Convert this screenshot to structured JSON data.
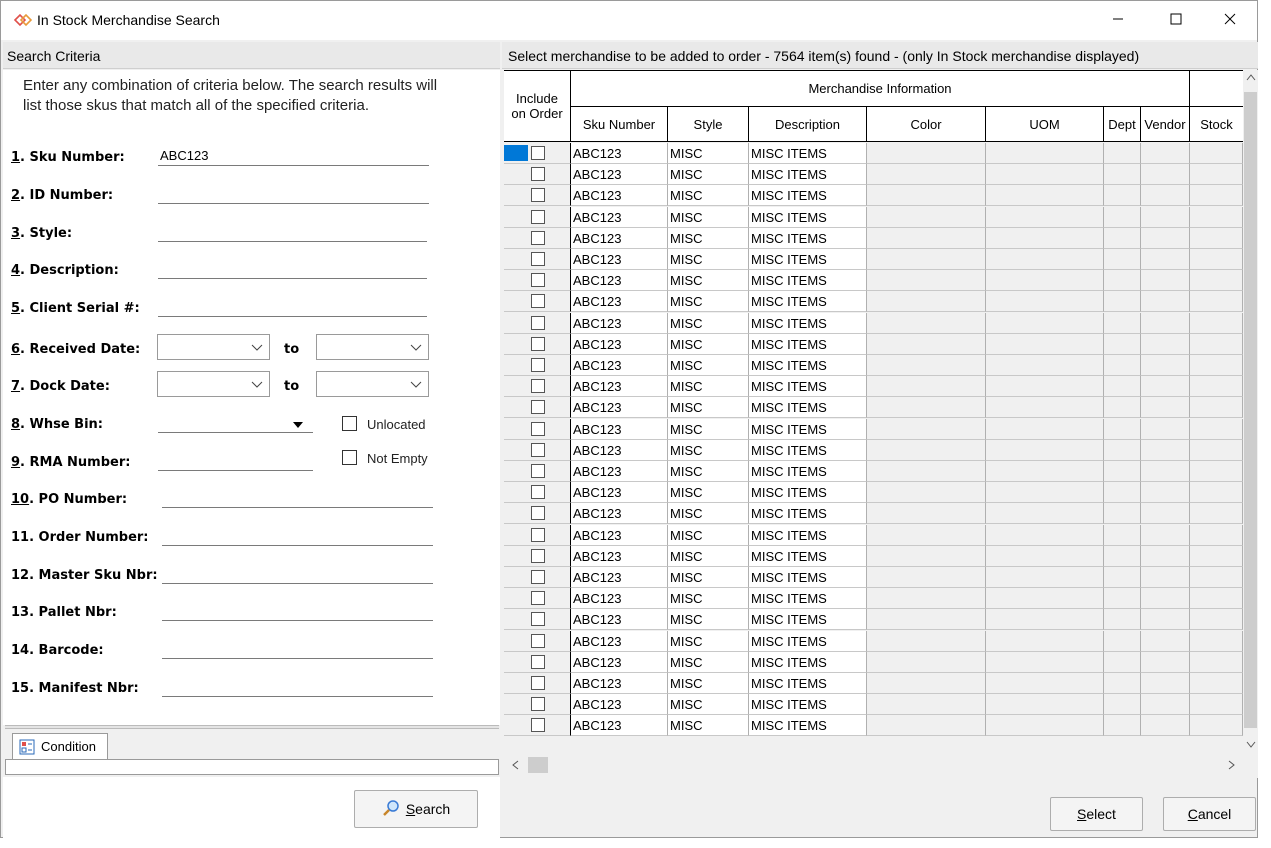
{
  "window": {
    "title": "In Stock Merchandise Search",
    "icons": [
      "app-logo-icon",
      "minimize-icon",
      "maximize-icon",
      "close-icon"
    ]
  },
  "criteria": {
    "header": "Search Criteria",
    "intro": "Enter any combination of criteria below.  The search results will list those skus that match all of the specified criteria.",
    "fields": {
      "sku": {
        "num": "1",
        "label": ". Sku Number:",
        "value": "ABC123"
      },
      "id": {
        "num": "2",
        "label": ". ID Number:",
        "value": ""
      },
      "style": {
        "num": "3",
        "label": ". Style:",
        "value": ""
      },
      "description": {
        "num": "4",
        "label": ". Description:",
        "value": ""
      },
      "serial": {
        "num": "5",
        "label": ". Client Serial #:",
        "value": ""
      },
      "received": {
        "num": "6",
        "label": ". Received Date:",
        "to": "to"
      },
      "dock": {
        "num": "7",
        "label": ". Dock Date:",
        "to": "to"
      },
      "whse": {
        "num": "8",
        "label": ". Whse Bin:",
        "value": ""
      },
      "rma": {
        "num": "9",
        "label": ". RMA Number:",
        "value": ""
      },
      "po": {
        "num": "10",
        "label": ". PO Number:",
        "value": ""
      },
      "order": {
        "num": "11",
        "label": ". Order Number:",
        "value": ""
      },
      "master": {
        "num": "12",
        "label": ". Master Sku Nbr:",
        "value": ""
      },
      "pallet": {
        "num": "13",
        "label": ". Pallet Nbr:",
        "value": ""
      },
      "barcode": {
        "num": "14",
        "label": ". Barcode:",
        "value": ""
      },
      "manifest": {
        "num": "15",
        "label": ". Manifest Nbr:",
        "value": ""
      }
    },
    "unlocated_label": "Unlocated",
    "not_empty_label": "Not Empty",
    "condition_tab": "Condition",
    "search_button": {
      "mnemonic": "S",
      "rest": "earch"
    }
  },
  "results": {
    "header": "Select merchandise to be added to order - 7564 item(s) found - (only In Stock merchandise displayed)",
    "include_header": "Include on Order",
    "group_header": "Merchandise Information",
    "columns": [
      "Sku Number",
      "Style",
      "Description",
      "Color",
      "UOM",
      "Dept",
      "Vendor",
      "Stock"
    ],
    "rows": [
      {
        "sku": "ABC123",
        "style": "MISC",
        "description": "MISC ITEMS",
        "checked": false
      },
      {
        "sku": "ABC123",
        "style": "MISC",
        "description": "MISC ITEMS",
        "checked": false
      },
      {
        "sku": "ABC123",
        "style": "MISC",
        "description": "MISC ITEMS",
        "checked": false
      },
      {
        "sku": "ABC123",
        "style": "MISC",
        "description": "MISC ITEMS",
        "checked": false
      },
      {
        "sku": "ABC123",
        "style": "MISC",
        "description": "MISC ITEMS",
        "checked": false
      },
      {
        "sku": "ABC123",
        "style": "MISC",
        "description": "MISC ITEMS",
        "checked": false
      },
      {
        "sku": "ABC123",
        "style": "MISC",
        "description": "MISC ITEMS",
        "checked": false
      },
      {
        "sku": "ABC123",
        "style": "MISC",
        "description": "MISC ITEMS",
        "checked": false
      },
      {
        "sku": "ABC123",
        "style": "MISC",
        "description": "MISC ITEMS",
        "checked": false
      },
      {
        "sku": "ABC123",
        "style": "MISC",
        "description": "MISC ITEMS",
        "checked": false
      },
      {
        "sku": "ABC123",
        "style": "MISC",
        "description": "MISC ITEMS",
        "checked": false
      },
      {
        "sku": "ABC123",
        "style": "MISC",
        "description": "MISC ITEMS",
        "checked": false
      },
      {
        "sku": "ABC123",
        "style": "MISC",
        "description": "MISC ITEMS",
        "checked": false
      },
      {
        "sku": "ABC123",
        "style": "MISC",
        "description": "MISC ITEMS",
        "checked": false
      },
      {
        "sku": "ABC123",
        "style": "MISC",
        "description": "MISC ITEMS",
        "checked": false
      },
      {
        "sku": "ABC123",
        "style": "MISC",
        "description": "MISC ITEMS",
        "checked": false
      },
      {
        "sku": "ABC123",
        "style": "MISC",
        "description": "MISC ITEMS",
        "checked": false
      },
      {
        "sku": "ABC123",
        "style": "MISC",
        "description": "MISC ITEMS",
        "checked": false
      },
      {
        "sku": "ABC123",
        "style": "MISC",
        "description": "MISC ITEMS",
        "checked": false
      },
      {
        "sku": "ABC123",
        "style": "MISC",
        "description": "MISC ITEMS",
        "checked": false
      },
      {
        "sku": "ABC123",
        "style": "MISC",
        "description": "MISC ITEMS",
        "checked": false
      },
      {
        "sku": "ABC123",
        "style": "MISC",
        "description": "MISC ITEMS",
        "checked": false
      },
      {
        "sku": "ABC123",
        "style": "MISC",
        "description": "MISC ITEMS",
        "checked": false
      },
      {
        "sku": "ABC123",
        "style": "MISC",
        "description": "MISC ITEMS",
        "checked": false
      },
      {
        "sku": "ABC123",
        "style": "MISC",
        "description": "MISC ITEMS",
        "checked": false
      },
      {
        "sku": "ABC123",
        "style": "MISC",
        "description": "MISC ITEMS",
        "checked": false
      },
      {
        "sku": "ABC123",
        "style": "MISC",
        "description": "MISC ITEMS",
        "checked": false
      },
      {
        "sku": "ABC123",
        "style": "MISC",
        "description": "MISC ITEMS",
        "checked": false
      }
    ],
    "select_button": {
      "mnemonic": "S",
      "rest": "elect"
    },
    "cancel_button": {
      "mnemonic": "C",
      "rest": "ancel"
    }
  },
  "colors": {
    "selection": "#0078d7",
    "accent": "#e0504a"
  }
}
